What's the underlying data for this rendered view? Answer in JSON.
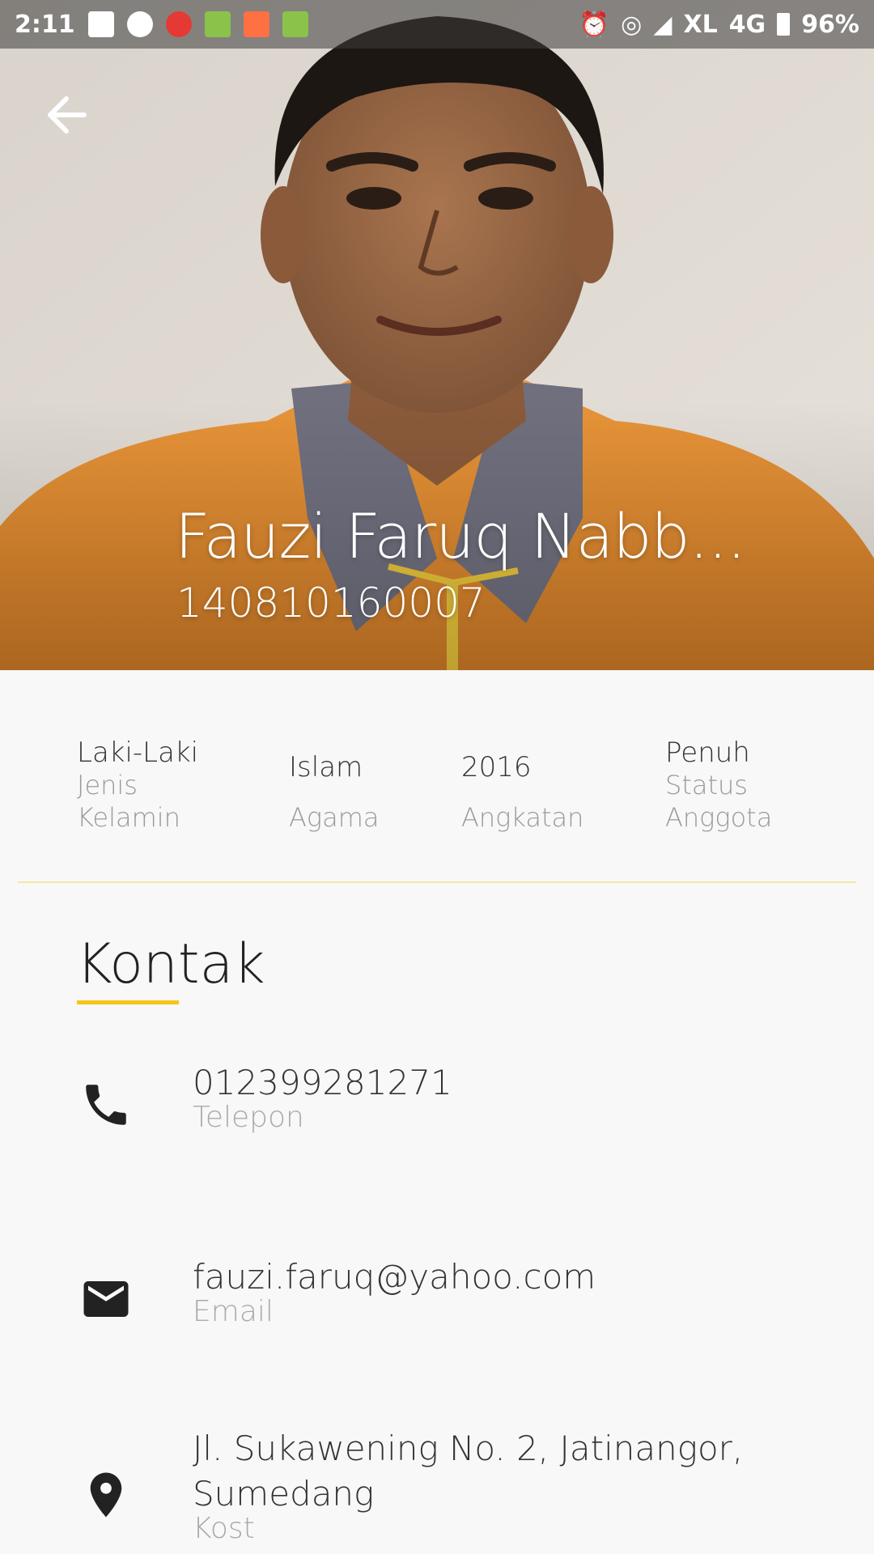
{
  "status_bar": {
    "time": "2:11",
    "carrier": "XL",
    "network": "4G",
    "battery": "96%"
  },
  "header": {
    "back_icon": "arrow-back-icon",
    "name": "Fauzi Faruq Nabb...",
    "id_number": "140810160007"
  },
  "info": [
    {
      "value": "Laki-Laki",
      "label": "Jenis Kelamin"
    },
    {
      "value": "Islam",
      "label": "Agama"
    },
    {
      "value": "2016",
      "label": "Angkatan"
    },
    {
      "value": "Penuh",
      "label": "Status Anggota"
    }
  ],
  "contact": {
    "title": "Kontak",
    "items": [
      {
        "icon": "phone-icon",
        "value": "012399281271",
        "label": "Telepon"
      },
      {
        "icon": "mail-icon",
        "value": "fauzi.faruq@yahoo.com",
        "label": "Email"
      },
      {
        "icon": "location-pin-icon",
        "value": "Jl. Sukawening No. 2, Jatinangor, Sumedang",
        "label": "Kost"
      }
    ]
  },
  "colors": {
    "accent": "#f5c518",
    "divider": "#f3e8a4",
    "background": "#f7f8f7"
  }
}
